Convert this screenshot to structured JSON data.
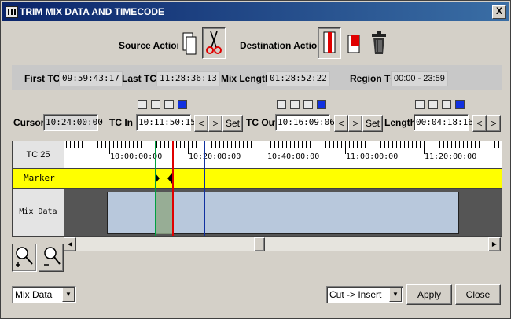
{
  "window": {
    "title": "TRIM MIX DATA AND TIMECODE",
    "close_label": "X"
  },
  "actions": {
    "source_label": "Source Action",
    "destination_label": "Destination Action"
  },
  "info": {
    "first_tc_label": "First TC",
    "first_tc": "09:59:43:17",
    "last_tc_label": "Last TC",
    "last_tc": "11:28:36:13",
    "mix_length_label": "Mix Length",
    "mix_length": "01:28:52:22",
    "region_tc_label": "Region TC",
    "region_tc": "00:00 - 23:59"
  },
  "controls": {
    "cursor_label": "Cursor",
    "cursor_value": "10:24:00:00",
    "tc_in_label": "TC In",
    "tc_in_value": "10:11:50:15",
    "tc_out_label": "TC Out",
    "tc_out_value": "10:16:09:06",
    "length_label": "Length",
    "length_value": "00:04:18:16",
    "prev_label": "<",
    "next_label": ">",
    "set_label": "Set"
  },
  "timeline": {
    "tc_label": "TC 25",
    "ticks": [
      "10:00:00:00",
      "10:20:00:00",
      "10:40:00:00",
      "11:00:00:00",
      "11:20:00:00"
    ],
    "marker_label": "Marker",
    "mix_data_label": "Mix Data"
  },
  "bottom": {
    "view_select": "Mix Data",
    "mode_select": "Cut -> Insert",
    "apply_label": "Apply",
    "close_label": "Close"
  },
  "colors": {
    "marker_track": "#ffff00",
    "mix_region": "#b8c8dc",
    "tc_in_line": "#00a040",
    "tc_out_line": "#e00000",
    "cursor_line": "#1030a0",
    "selected_block": "#1030e0"
  }
}
